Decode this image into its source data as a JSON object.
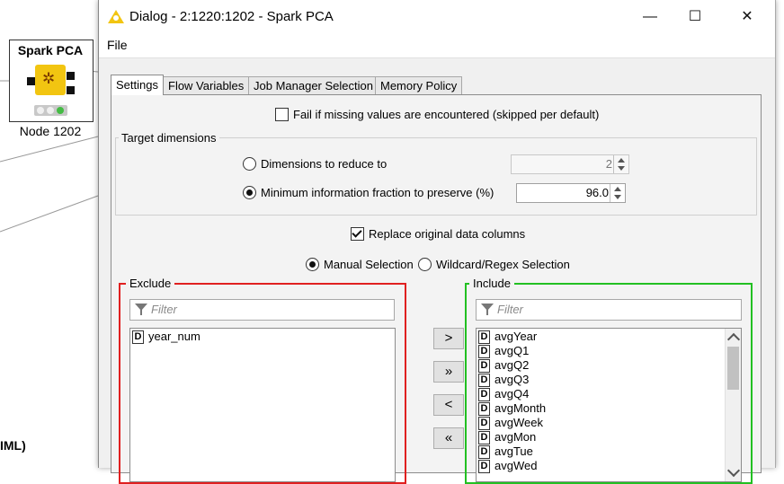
{
  "canvas": {
    "node_title": "Spark PCA",
    "node_label": "Node 1202",
    "partial_label": "IML)"
  },
  "dialog": {
    "title": "Dialog - 2:1220:1202 - Spark PCA",
    "window_buttons": {
      "minimize": "—",
      "maximize": "☐",
      "close": "✕"
    },
    "menu": {
      "file": "File"
    },
    "tabs": [
      "Settings",
      "Flow Variables",
      "Job Manager Selection",
      "Memory Policy"
    ],
    "active_tab": "Settings",
    "settings": {
      "fail_missing_label": "Fail if missing values are encountered (skipped per default)",
      "fail_missing_checked": false,
      "target_dimensions_title": "Target dimensions",
      "dims_reduce_label": "Dimensions to reduce to",
      "dims_reduce_value": "2",
      "dims_reduce_selected": false,
      "min_info_label": "Minimum information fraction to preserve (%)",
      "min_info_value": "96.0",
      "min_info_selected": true,
      "replace_label": "Replace original data columns",
      "replace_checked": true,
      "manual_selection_label": "Manual Selection",
      "manual_selected": true,
      "wildcard_label": "Wildcard/Regex Selection",
      "exclude": {
        "title": "Exclude",
        "filter_placeholder": "Filter",
        "items": [
          {
            "type": "D",
            "name": "year_num"
          }
        ]
      },
      "include": {
        "title": "Include",
        "filter_placeholder": "Filter",
        "items": [
          {
            "type": "D",
            "name": "avgYear"
          },
          {
            "type": "D",
            "name": "avgQ1"
          },
          {
            "type": "D",
            "name": "avgQ2"
          },
          {
            "type": "D",
            "name": "avgQ3"
          },
          {
            "type": "D",
            "name": "avgQ4"
          },
          {
            "type": "D",
            "name": "avgMonth"
          },
          {
            "type": "D",
            "name": "avgWeek"
          },
          {
            "type": "D",
            "name": "avgMon"
          },
          {
            "type": "D",
            "name": "avgTue"
          },
          {
            "type": "D",
            "name": "avgWed"
          }
        ]
      },
      "move_buttons": {
        "add": ">",
        "add_all": "»",
        "remove": "<",
        "remove_all": "«"
      }
    }
  },
  "colors": {
    "exclude_border": "#e02020",
    "include_border": "#22c022",
    "node_icon": "#f2c511",
    "status_light": "#44bb44"
  }
}
